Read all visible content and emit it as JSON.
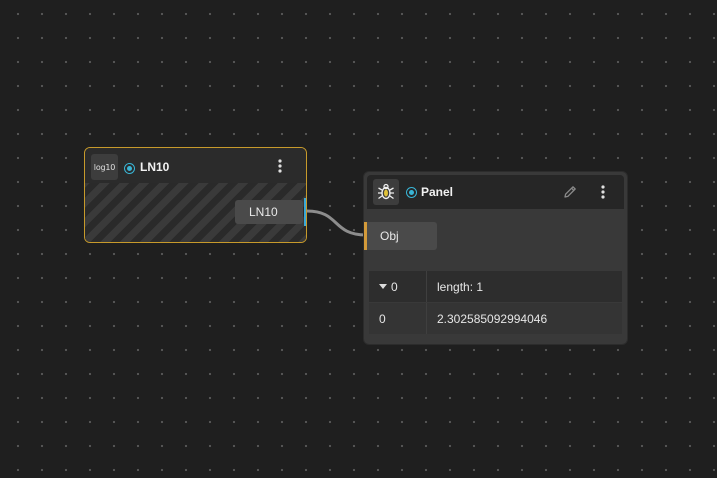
{
  "canvas": {
    "background_color": "#1f1f1f",
    "grid_dot_color": "#5a5a5a"
  },
  "nodes": {
    "ln10": {
      "icon_label": "log10",
      "title": "LN10",
      "menu_icon": "vertical-ellipsis-icon",
      "output_label": "LN10",
      "border_color": "#c79a2b",
      "port_color": "#3aa8d6",
      "status_color": "#39b5d6"
    },
    "panel": {
      "icon": "bug-icon",
      "title": "Panel",
      "edit_icon": "pencil-icon",
      "menu_icon": "vertical-ellipsis-icon",
      "input_label": "Obj",
      "input_port_color": "#d39a3a",
      "table": {
        "header": {
          "key": "0",
          "value": "length: 1",
          "expanded": true
        },
        "rows": [
          {
            "key": "0",
            "value": "2.302585092994046"
          }
        ]
      }
    }
  }
}
